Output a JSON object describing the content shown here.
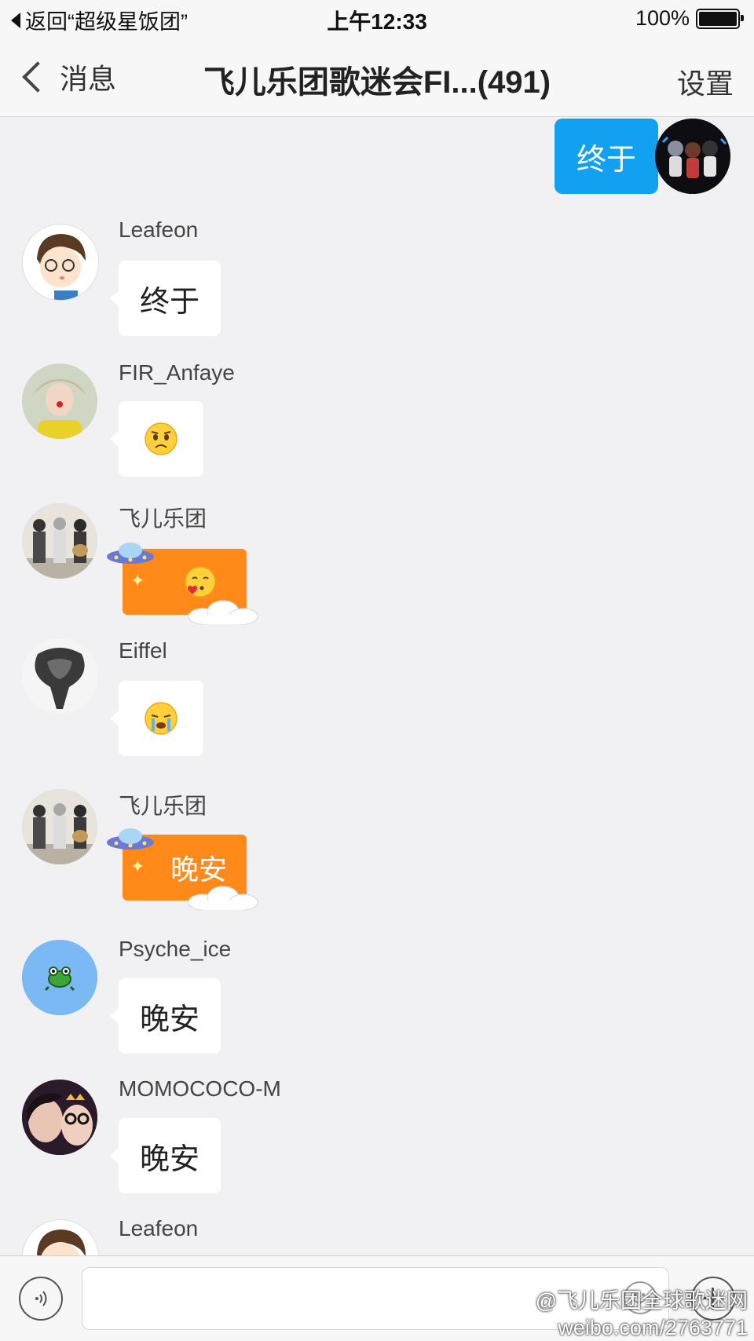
{
  "status_bar": {
    "back_app": "返回“超级星饭团”",
    "time": "上午12:33",
    "battery": "100%"
  },
  "nav": {
    "back_label": "消息",
    "title": "飞儿乐团歌迷会FI...(491)",
    "settings_label": "设置"
  },
  "messages": [
    {
      "sender": "",
      "text": "终于",
      "self": true
    },
    {
      "sender": "Leafeon",
      "text": "终于"
    },
    {
      "sender": "FIR_Anfaye",
      "text": "",
      "emoji": "pleading-face-emoji"
    },
    {
      "sender": "飞儿乐团",
      "text": "",
      "emoji": "kissing-heart-emoji",
      "style": "orange-ufo-bubble"
    },
    {
      "sender": "Eiffel",
      "text": "",
      "emoji": "crying-face-emoji"
    },
    {
      "sender": "飞儿乐团",
      "text": "晚安",
      "style": "orange-ufo-bubble"
    },
    {
      "sender": "Psyche_ice",
      "text": "晚安"
    },
    {
      "sender": "MOMOCOCO-M",
      "text": "晚安"
    },
    {
      "sender": "Leafeon",
      "text": ""
    }
  ],
  "input_bar": {
    "placeholder": ""
  },
  "watermark": {
    "line1": "@飞儿乐团全球歌迷网",
    "line2": "weibo.com/2763771"
  },
  "colors": {
    "self_bubble": "#12a1f1",
    "orange_bubble": "#ff8a1a",
    "background": "#f1f1f3"
  }
}
